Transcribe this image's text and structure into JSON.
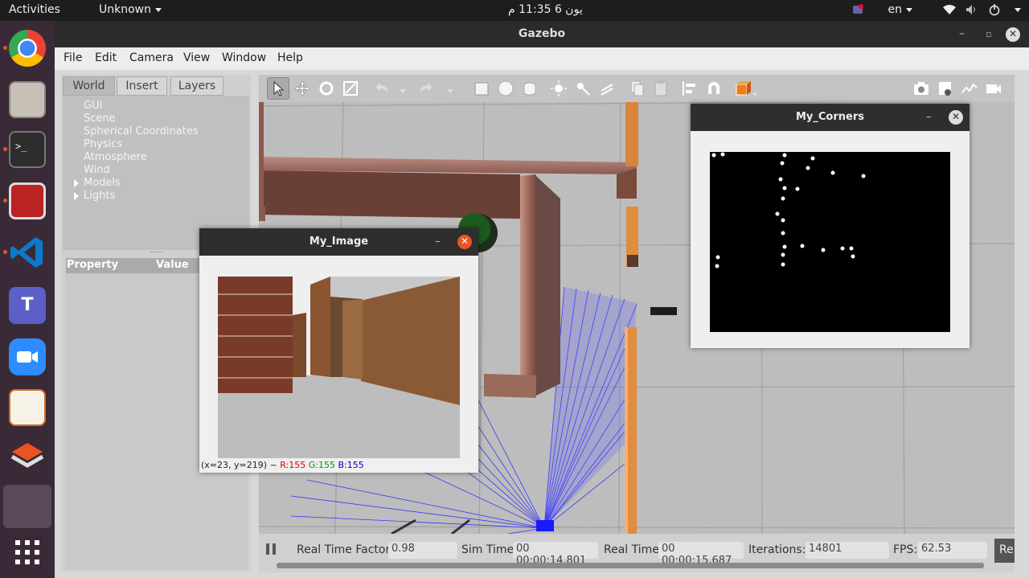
{
  "topbar": {
    "activities": "Activities",
    "app_menu": "Unknown",
    "clock": "يون 6  11:35 م",
    "lang": "en"
  },
  "dock": {
    "items": [
      "chrome-icon",
      "files-icon",
      "terminal-icon",
      "app-icon",
      "vscode-icon",
      "teams-icon",
      "zoom-icon",
      "impress-icon",
      "installer-icon",
      "active-app-icon",
      "show-apps-icon"
    ]
  },
  "window": {
    "title": "Gazebo"
  },
  "menubar": {
    "items": [
      "File",
      "Edit",
      "Camera",
      "View",
      "Window",
      "Help"
    ]
  },
  "left_panel": {
    "tabs": [
      "World",
      "Insert",
      "Layers"
    ],
    "tree": [
      "GUI",
      "Scene",
      "Spherical Coordinates",
      "Physics",
      "Atmosphere",
      "Wind",
      "Models",
      "Lights"
    ],
    "property_header": "Property",
    "value_header": "Value"
  },
  "status": {
    "rtf_label": "Real Time Factor:",
    "rtf_value": "0.98",
    "sim_label": "Sim Time:",
    "sim_value": "00 00:00:14.801",
    "real_label": "Real Time:",
    "real_value": "00 00:00:15.687",
    "iter_label": "Iterations:",
    "iter_value": "14801",
    "fps_label": "FPS:",
    "fps_value": "62.53",
    "reset_label": "Re"
  },
  "my_image": {
    "title": "My_Image",
    "status_coords": "(x=23, y=219) ~",
    "status_r": "R:155",
    "status_g": "G:155",
    "status_b": "B:155"
  },
  "my_corners": {
    "title": "My_Corners"
  },
  "colors": {
    "accent": "#e95420",
    "laser": "#2a2aff",
    "wood": "#d9843a"
  }
}
